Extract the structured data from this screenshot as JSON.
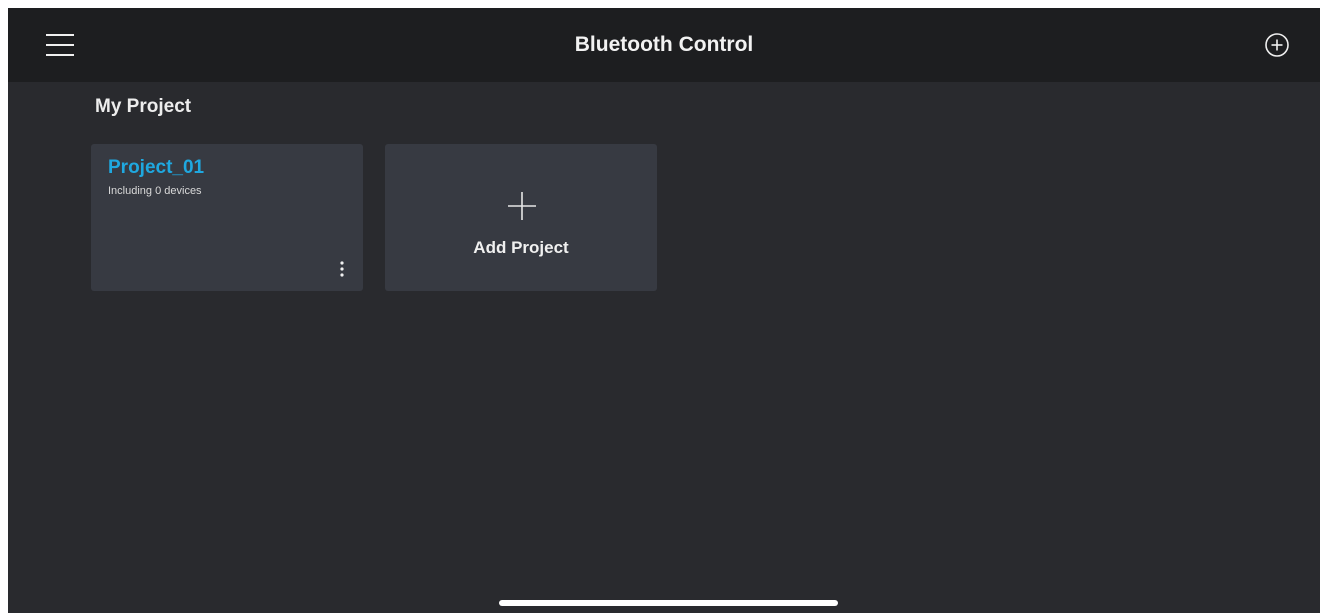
{
  "header": {
    "title": "Bluetooth Control",
    "menu_icon": "hamburger-menu-icon",
    "add_icon": "add-circle-icon"
  },
  "section": {
    "title": "My Project"
  },
  "projects": [
    {
      "name": "Project_01",
      "subtitle": "Including 0 devices",
      "more_icon": "more-vertical-icon"
    }
  ],
  "add_card": {
    "label": "Add Project",
    "icon": "plus-icon"
  },
  "colors": {
    "background": "#292a2e",
    "topbar": "#1d1e20",
    "card": "#373a42",
    "accent": "#1fa8e0",
    "text": "#f2f2f2"
  }
}
